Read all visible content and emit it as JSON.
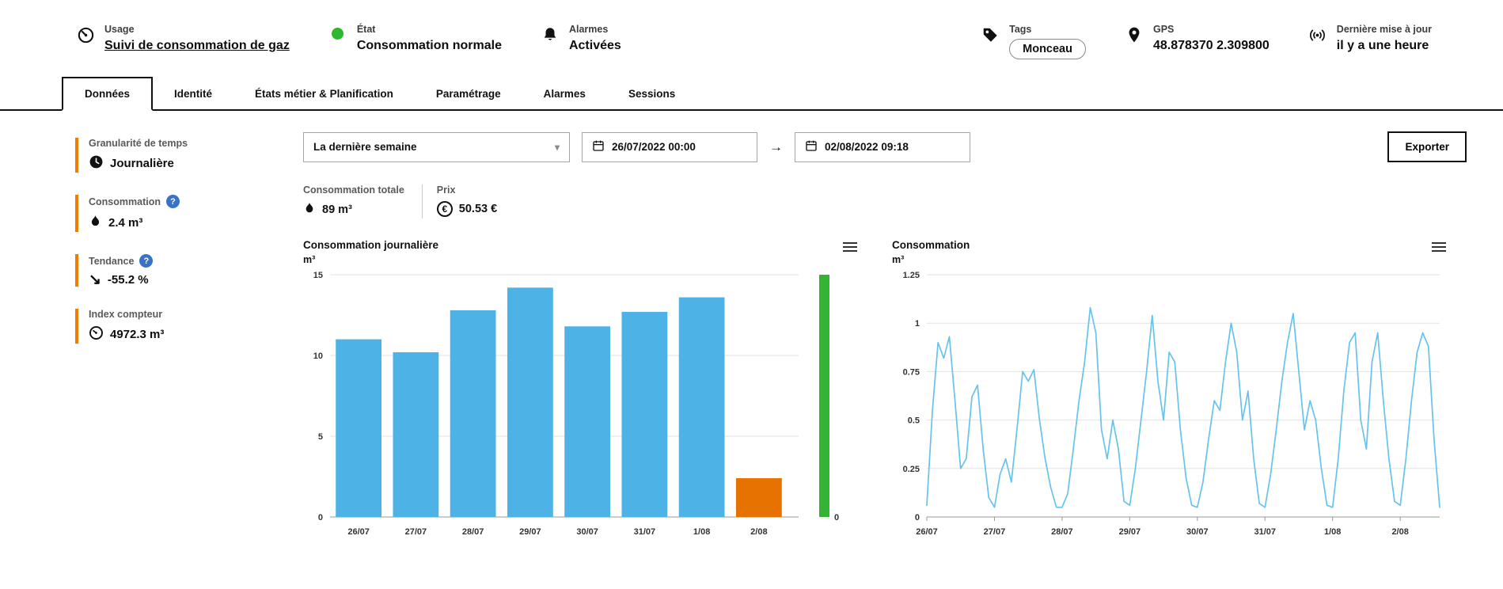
{
  "colors": {
    "accent_orange": "#f07d00",
    "bar_blue": "#4db3e6",
    "bar_orange": "#e87200",
    "line_blue": "#66c3ec",
    "gauge_green": "#33b533",
    "status_green": "#2eb82e",
    "help_blue": "#3873c8"
  },
  "header": {
    "usage": {
      "label": "Usage",
      "value": "Suivi de consommation de gaz",
      "icon": "gauge-icon"
    },
    "etat": {
      "label": "État",
      "value": "Consommation normale",
      "icon": "status-dot"
    },
    "alarmes": {
      "label": "Alarmes",
      "value": "Activées",
      "icon": "bell-icon"
    },
    "tags": {
      "label": "Tags",
      "value": "Monceau",
      "icon": "tag-icon"
    },
    "gps": {
      "label": "GPS",
      "value": "48.878370 2.309800",
      "icon": "map-pin-icon"
    },
    "maj": {
      "label": "Dernière mise à jour",
      "value": "il y a une heure",
      "icon": "broadcast-icon"
    }
  },
  "tabs": [
    {
      "label": "Données",
      "active": true
    },
    {
      "label": "Identité",
      "active": false
    },
    {
      "label": "États métier & Planification",
      "active": false
    },
    {
      "label": "Paramétrage",
      "active": false
    },
    {
      "label": "Alarmes",
      "active": false
    },
    {
      "label": "Sessions",
      "active": false
    }
  ],
  "sidebar": [
    {
      "label": "Granularité de temps",
      "value": "Journalière",
      "icon": "clock-icon",
      "help": false
    },
    {
      "label": "Consommation",
      "value": "2.4 m³",
      "icon": "flame-icon",
      "help": true
    },
    {
      "label": "Tendance",
      "value": "-55.2 %",
      "icon": "trend-down-icon",
      "help": true
    },
    {
      "label": "Index compteur",
      "value": "4972.3 m³",
      "icon": "meter-icon",
      "help": false
    }
  ],
  "filters": {
    "period": "La dernière semaine",
    "date_from": "26/07/2022 00:00",
    "date_to": "02/08/2022 09:18",
    "export_label": "Exporter"
  },
  "totals": {
    "consumption_label": "Consommation totale",
    "consumption_value": "89 m³",
    "price_label": "Prix",
    "price_value": "50.53 €"
  },
  "chart_data": [
    {
      "type": "bar",
      "title": "Consommation journalière",
      "ylabel": "m³",
      "categories": [
        "26/07",
        "27/07",
        "28/07",
        "29/07",
        "30/07",
        "31/07",
        "1/08",
        "2/08"
      ],
      "values": [
        11,
        10.2,
        12.8,
        14.2,
        11.8,
        12.7,
        13.6,
        2.4
      ],
      "bar_colors": [
        "#4db3e6",
        "#4db3e6",
        "#4db3e6",
        "#4db3e6",
        "#4db3e6",
        "#4db3e6",
        "#4db3e6",
        "#e87200"
      ],
      "ylim": [
        0,
        15
      ],
      "yticks": [
        0,
        5,
        10,
        15
      ],
      "grid": true,
      "gauge": {
        "color": "#33b533",
        "label": "0"
      }
    },
    {
      "type": "line",
      "title": "Consommation",
      "ylabel": "m³",
      "ylim": [
        0,
        1.25
      ],
      "yticks": [
        0,
        0.25,
        0.5,
        0.75,
        1,
        1.25
      ],
      "grid": true,
      "line_color": "#66c3ec",
      "x_tick_labels": [
        "26/07",
        "27/07",
        "28/07",
        "29/07",
        "30/07",
        "31/07",
        "1/08",
        "2/08"
      ],
      "x_tick_indices": [
        0,
        12,
        24,
        36,
        48,
        60,
        72,
        84
      ],
      "values": [
        0.06,
        0.55,
        0.9,
        0.82,
        0.93,
        0.6,
        0.25,
        0.3,
        0.62,
        0.68,
        0.35,
        0.1,
        0.05,
        0.22,
        0.3,
        0.18,
        0.45,
        0.75,
        0.7,
        0.76,
        0.5,
        0.3,
        0.15,
        0.05,
        0.05,
        0.12,
        0.35,
        0.6,
        0.8,
        1.08,
        0.95,
        0.45,
        0.3,
        0.5,
        0.35,
        0.08,
        0.06,
        0.25,
        0.5,
        0.75,
        1.04,
        0.7,
        0.5,
        0.85,
        0.8,
        0.45,
        0.2,
        0.06,
        0.05,
        0.18,
        0.4,
        0.6,
        0.55,
        0.8,
        1.0,
        0.85,
        0.5,
        0.65,
        0.3,
        0.07,
        0.05,
        0.22,
        0.45,
        0.7,
        0.9,
        1.05,
        0.75,
        0.45,
        0.6,
        0.5,
        0.25,
        0.06,
        0.05,
        0.3,
        0.65,
        0.9,
        0.95,
        0.5,
        0.35,
        0.8,
        0.95,
        0.6,
        0.3,
        0.08,
        0.06,
        0.3,
        0.6,
        0.85,
        0.95,
        0.88,
        0.4,
        0.05
      ]
    }
  ]
}
